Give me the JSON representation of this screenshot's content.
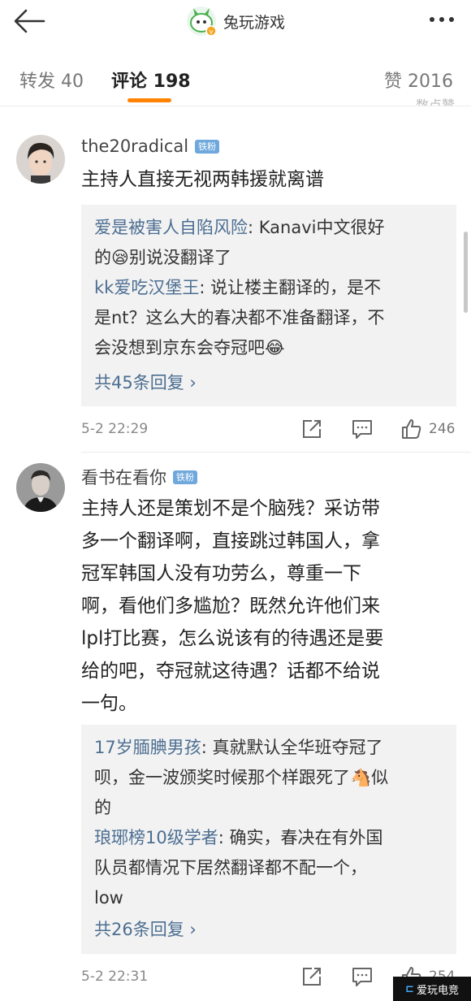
{
  "header": {
    "title": "兔玩游戏"
  },
  "tabs": [
    {
      "label": "转发 40"
    },
    {
      "label": "评论 198"
    },
    {
      "label": "赞 2016"
    }
  ],
  "partial_top": "…数点赞",
  "comments": [
    {
      "username": "the20radical",
      "badge": "铁粉",
      "text": "主持人直接无视两韩援就离谱",
      "replies": [
        {
          "name": "爱是被害人自陷风险",
          "text_line1": "Kanavi中文很好",
          "text_line2a": "的",
          "emoji": "😪",
          "text_line2b": "别说没翻译了"
        },
        {
          "name": "kk爱吃汉堡王",
          "text_line1": "说让楼主翻译的，是不",
          "text_line2": "是nt？这么大的春决都不准备翻译，不",
          "text_line3": "会没想到京东会夺冠吧",
          "emoji": "😂"
        }
      ],
      "more_replies": "共45条回复 ›",
      "time": "5-2 22:29",
      "likes": "246"
    },
    {
      "username": "看书在看你",
      "badge": "铁粉",
      "text_lines": [
        "主持人还是策划不是个脑残？采访带",
        "多一个翻译啊，直接跳过韩国人，拿",
        "冠军韩国人没有功劳么，尊重一下",
        "啊，看他们多尴尬？既然允许他们来",
        "lpl打比赛，怎么说该有的待遇还是要",
        "给的吧，夺冠就这待遇？话都不给说",
        "一句。"
      ],
      "replies": [
        {
          "name": "17岁腼腆男孩",
          "line1": "真就默认全华班夺冠了",
          "line2a": "呗，金一波颁奖时候那个样跟死了",
          "emoji": "🐴",
          "line2b": "似",
          "line3": "的"
        },
        {
          "name": "琅琊榜10级学者",
          "line1": "确实，春决在有外国",
          "line2": "队员都情况下居然翻译都不配一个，",
          "line3": "low"
        }
      ],
      "more_replies": "共26条回复 ›",
      "time": "5-2 22:31",
      "likes": "254"
    }
  ],
  "watermark": "爱玩电竞",
  "colors": {
    "accent": "#ff8200",
    "link": "#4c6e92",
    "badge": "#6fa8dc"
  }
}
